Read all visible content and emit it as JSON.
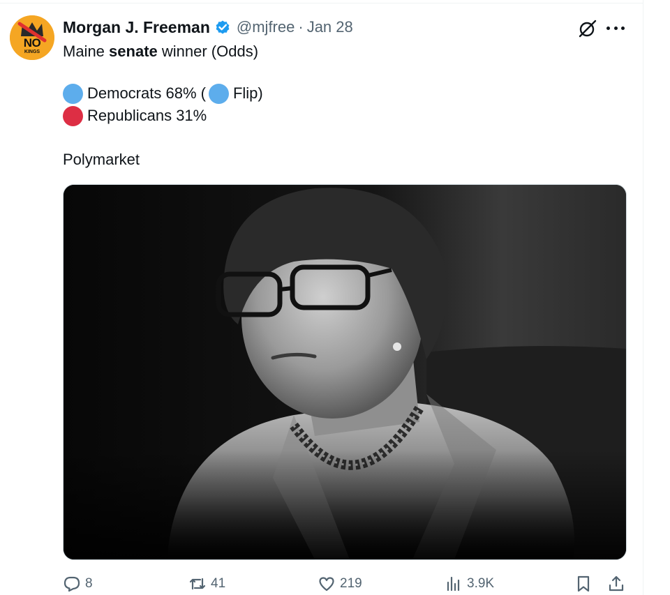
{
  "author": {
    "display_name": "Morgan J. Freeman",
    "handle": "@mjfree",
    "separator": "·",
    "date": "Jan 28",
    "avatar_text_top": "NO",
    "avatar_text_bottom": "KINGS",
    "verified_icon": "verified-badge-icon"
  },
  "tweet": {
    "line1_pre": "Maine ",
    "line1_bold": "senate",
    "line1_post": " winner (Odds)",
    "dem_label": "Democrats 68% (",
    "flip_label": "Flip)",
    "rep_label": "Republicans 31%",
    "source": "Polymarket",
    "emoji_colors": {
      "blue": "#5dadec",
      "red": "#dd2e44"
    },
    "media_description": "black-and-white portrait photo"
  },
  "actions": {
    "replies": "8",
    "reposts": "41",
    "likes": "219",
    "views": "3.9K"
  },
  "colors": {
    "text_primary": "#0f1419",
    "text_secondary": "#536471",
    "verified_blue": "#1d9bf0",
    "border": "#cfd9de"
  }
}
